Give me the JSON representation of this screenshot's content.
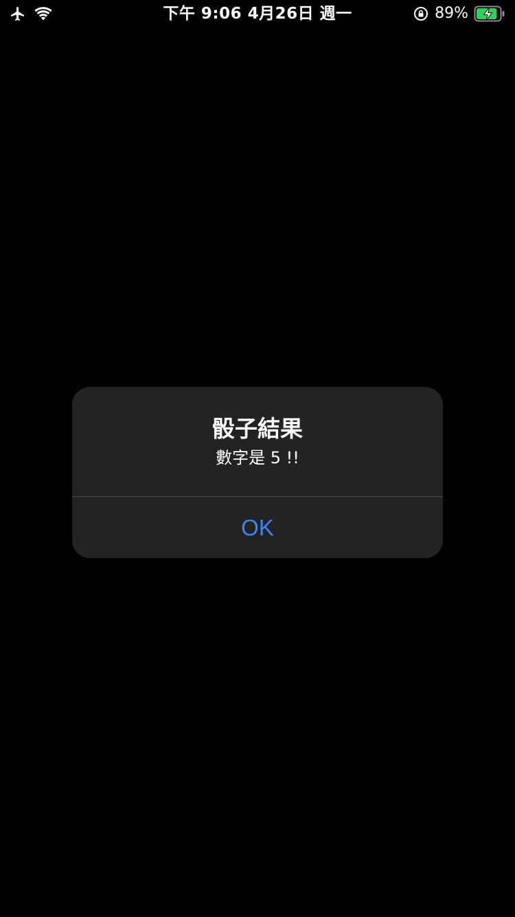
{
  "status_bar": {
    "time_date": "下午 9:06  4月26日 週一",
    "battery_percent": "89%",
    "icons": [
      "airplane-icon",
      "wifi-icon",
      "orientation-lock-icon",
      "battery-charging-icon"
    ],
    "battery_color": "#30d158",
    "battery_level": 0.89
  },
  "alert": {
    "title": "骰子結果",
    "message": "數字是 5 !!",
    "button_label": "OK",
    "button_color": "#3b86f0",
    "background_color": "#232323"
  }
}
